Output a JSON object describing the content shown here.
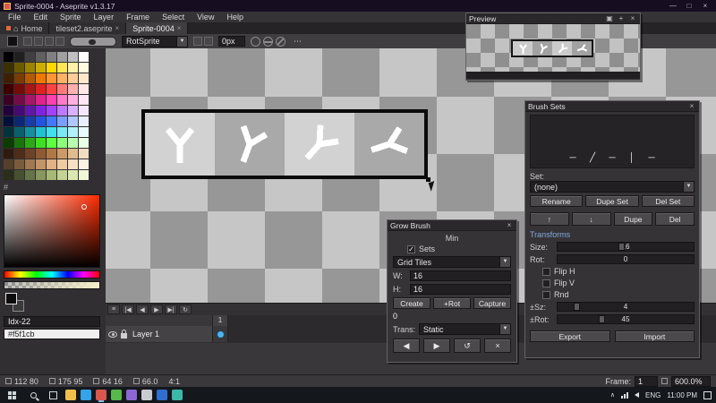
{
  "titlebar": {
    "title": "Sprite-0004 - Aseprite v1.3.17",
    "minimize": "—",
    "maximize": "□",
    "close": "×"
  },
  "menubar": {
    "items": [
      "File",
      "Edit",
      "Sprite",
      "Layer",
      "Frame",
      "Select",
      "View",
      "Help"
    ]
  },
  "tabbar": {
    "home_icon": "⌂",
    "home_label": "Home",
    "tabs": [
      {
        "label": "tileset2.aseprite",
        "close": "×"
      },
      {
        "label": "Sprite-0004",
        "close": "×"
      }
    ]
  },
  "contextbar": {
    "rotsprite_label": "RotSprite",
    "caret": "▼",
    "px_value": "0px",
    "more": "⋯"
  },
  "palette": {
    "index_label": "#",
    "index_value": "Idx-22",
    "hex_value": "#f5f1cb",
    "colors": [
      "#000000",
      "#202020",
      "#404040",
      "#606060",
      "#808080",
      "#a0a0a0",
      "#c0c0c0",
      "#ffffff",
      "#3a3000",
      "#6b5a00",
      "#9c8400",
      "#cdae00",
      "#ffd800",
      "#ffe655",
      "#fff2a8",
      "#fffbe0",
      "#3f1f00",
      "#7a3c00",
      "#b55a00",
      "#f07800",
      "#ff9633",
      "#ffb266",
      "#ffcd99",
      "#ffe8cc",
      "#3c0000",
      "#730b0b",
      "#aa1616",
      "#e12121",
      "#ff4242",
      "#ff7a7a",
      "#ffb1b1",
      "#ffe8e8",
      "#3c0023",
      "#730b46",
      "#aa1669",
      "#e1218c",
      "#ff42af",
      "#ff7ac7",
      "#ffb1df",
      "#ffe8f5",
      "#22003c",
      "#420b73",
      "#6116aa",
      "#8121e1",
      "#a142ff",
      "#bd7aff",
      "#d9b1ff",
      "#f4e8ff",
      "#00103c",
      "#0b2773",
      "#163eaa",
      "#2155e1",
      "#4279ff",
      "#7aa0ff",
      "#b1c7ff",
      "#e8efff",
      "#00333a",
      "#0b5f6e",
      "#1690a0",
      "#21c2d4",
      "#42e0ef",
      "#7ae9f4",
      "#b1f2f8",
      "#e8fcfe",
      "#0b3c00",
      "#1b730b",
      "#2caa16",
      "#3ee121",
      "#5eff42",
      "#8cff7a",
      "#baffb1",
      "#eaffe8",
      "#2e1a0e",
      "#4d2d18",
      "#6e4224",
      "#8f5a33",
      "#b07845",
      "#cc9a66",
      "#e0bc90",
      "#f0dcc0",
      "#55402a",
      "#7a5c3c",
      "#9f7850",
      "#c49468",
      "#e0b284",
      "#f0cba2",
      "#f8e0c4",
      "#fdf2e4",
      "#2a2e1a",
      "#475030",
      "#657348",
      "#87975f",
      "#a7b977",
      "#c3d393",
      "#dce8b4",
      "#f0f8d8"
    ]
  },
  "preview": {
    "title": "Preview",
    "icons": {
      "dock": "▣",
      "center": "+",
      "close": "×"
    }
  },
  "brushsets": {
    "title": "Brush Sets",
    "close": "×",
    "brushes": [
      "─",
      "╱",
      "─",
      "│",
      "─"
    ],
    "set_label": "Set:",
    "set_value": "(none)",
    "caret": "▼",
    "rename": "Rename",
    "dupe_set": "Dupe Set",
    "del_set": "Del Set",
    "up": "↑",
    "down": "↓",
    "dupe": "Dupe",
    "del": "Del",
    "transforms": "Transforms",
    "size_label": "Size:",
    "size_value": "16",
    "rot_label": "Rot:",
    "rot_value": "0",
    "flip_h": "Flip H",
    "flip_v": "Flip V",
    "rnd": "Rnd",
    "dsz_label": "±Sz:",
    "dsz_value": "4",
    "drot_label": "±Rot:",
    "drot_value": "45",
    "export": "Export",
    "import": "Import"
  },
  "growbrush": {
    "title": "Grow Brush",
    "close": "×",
    "min_label": "Min",
    "sets_label": "Sets",
    "check": "✓",
    "grid_value": "Grid Tiles",
    "caret": "▼",
    "w_label": "W:",
    "w_value": "16",
    "h_label": "H:",
    "h_value": "16",
    "create": "Create",
    "plus_rot": "+Rot",
    "capture": "Capture",
    "zero": "0",
    "trans_label": "Trans:",
    "trans_value": "Static",
    "prev": "◀",
    "play": "▶",
    "loop": "↺",
    "stop": "×"
  },
  "timeline": {
    "controls": [
      "≡",
      "|◀",
      "◀",
      "▶",
      "▶|",
      "↻"
    ],
    "frame_header": "1",
    "layer_name": "Layer 1"
  },
  "statusbar": {
    "size": "112 80",
    "position": "175 95",
    "grid": "64 16",
    "angle": "66.0",
    "ratio": "4:1",
    "frame_label": "Frame:",
    "frame_value": "1",
    "zoom_value": "600.0%"
  },
  "taskbar": {
    "chevron": "∧",
    "lang": "ENG",
    "time": "11:00 PM",
    "apps": [
      {
        "name": "taskbar-app-folder",
        "color": "#f0c04a"
      },
      {
        "name": "taskbar-app-edge",
        "color": "#35a3e8"
      },
      {
        "name": "taskbar-app-aseprite",
        "color": "#d8574f",
        "active": true
      },
      {
        "name": "taskbar-app-green",
        "color": "#57b84c"
      },
      {
        "name": "taskbar-app-purple",
        "color": "#8b67d6"
      },
      {
        "name": "taskbar-app-light",
        "color": "#c8ccd0"
      },
      {
        "name": "taskbar-app-blue",
        "color": "#2f6fd0"
      },
      {
        "name": "taskbar-app-teal",
        "color": "#3cb8a9"
      }
    ]
  }
}
